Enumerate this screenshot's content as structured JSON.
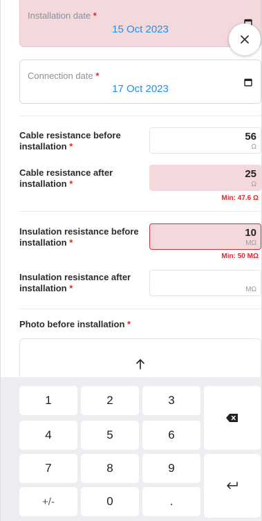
{
  "installation_date": {
    "label": "Installation date",
    "required": "*",
    "value": "15 Oct 2023"
  },
  "connection_date": {
    "label": "Connection date",
    "required": "*",
    "value": "17 Oct 2023"
  },
  "close_button": {
    "icon": "close-icon"
  },
  "fields": [
    {
      "label": "Cable resistance before installation",
      "required": "*",
      "value": "56",
      "unit": "Ω",
      "hint": ""
    },
    {
      "label": "Cable resistance after installation",
      "required": "*",
      "value": "25",
      "unit": "Ω",
      "hint": "Min: 47.6 Ω"
    },
    {
      "label": "Insulation resistance before installation",
      "required": "*",
      "value": "10",
      "unit": "MΩ",
      "hint": "Min: 50 MΩ"
    },
    {
      "label": "Insulation resistance after installation",
      "required": "*",
      "value": "",
      "unit": "MΩ",
      "hint": ""
    }
  ],
  "photo_before": {
    "label": "Photo before installation",
    "required": "*",
    "icon": "upload-arrow-icon"
  },
  "keypad": {
    "keys": [
      "1",
      "2",
      "3",
      "4",
      "5",
      "6",
      "7",
      "8",
      "9",
      "+/-",
      "0",
      "."
    ],
    "backspace_icon": "backspace-icon",
    "enter_icon": "enter-icon"
  },
  "colors": {
    "accent": "#1f8ef1",
    "error": "#e0262f",
    "error_bg": "#f3d9dc",
    "keypad_bg": "#eceef1"
  }
}
